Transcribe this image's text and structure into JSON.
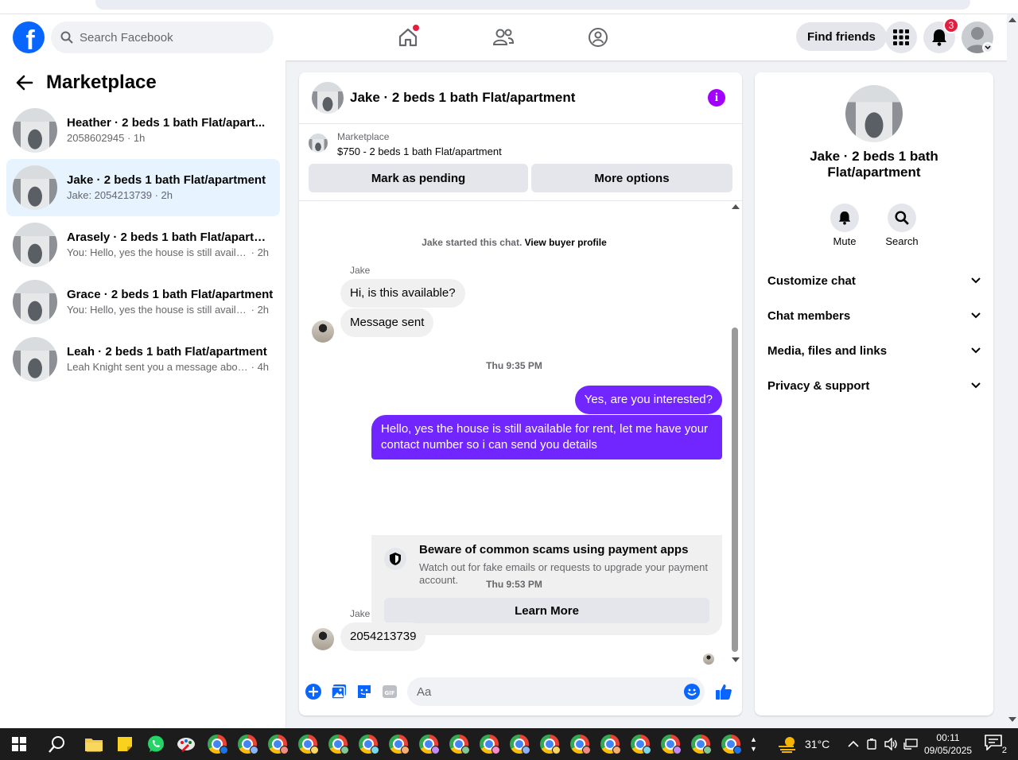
{
  "navbar": {
    "search_placeholder": "Search Facebook",
    "find_friends_label": "Find friends",
    "notification_count": "3"
  },
  "sidebar": {
    "title": "Marketplace",
    "conversations": [
      {
        "title": "Heather · 2 beds 1 bath Flat/apart...",
        "preview": "2058602945",
        "time": "· 1h",
        "active": false
      },
      {
        "title": "Jake · 2 beds 1 bath Flat/apartment",
        "preview": "Jake: 2054213739",
        "time": "· 2h",
        "active": true
      },
      {
        "title": "Arasely · 2 beds 1 bath Flat/apartm...",
        "preview": "You: Hello, yes the house is still availa...",
        "time": "· 2h",
        "active": false
      },
      {
        "title": "Grace · 2 beds 1 bath Flat/apartment",
        "preview": "You: Hello, yes the house is still availa...",
        "time": "· 2h",
        "active": false
      },
      {
        "title": "Leah · 2 beds 1 bath Flat/apartment",
        "preview": "Leah Knight sent you a message abou...",
        "time": "· 4h",
        "active": false
      }
    ]
  },
  "chat": {
    "header_title": "Jake · 2 beds 1 bath Flat/apartment",
    "listing": {
      "source": "Marketplace",
      "price_title": "$750 - 2 beds 1 bath Flat/apartment",
      "mark_pending_label": "Mark as pending",
      "more_options_label": "More options"
    },
    "started_text": "Jake started this chat.",
    "view_profile_label": "View buyer profile",
    "sender_name": "Jake",
    "msg_hi": "Hi, is this available?",
    "msg_sent": "Message sent",
    "time_1": "Thu 9:35 PM",
    "msg_out_1": "Yes, are you interested?",
    "msg_out_2": "Hello, yes the house is still available for rent, let me have your contact number so i can send you details",
    "scam_title": "Beware of common scams using payment apps",
    "scam_body": "Watch out for fake emails or requests to upgrade your payment account.",
    "learn_more_label": "Learn More",
    "time_2": "Thu 9:53 PM",
    "msg_number": "2054213739",
    "composer_placeholder": "Aa"
  },
  "info_pane": {
    "name": "Jake · 2 beds 1 bath Flat/apartment",
    "mute_label": "Mute",
    "search_label": "Search",
    "rows": [
      "Customize chat",
      "Chat members",
      "Media, files and links",
      "Privacy & support"
    ]
  },
  "taskbar": {
    "temperature": "31°C",
    "time": "00:11",
    "date": "09/05/2025",
    "notification_count": "2"
  },
  "colors": {
    "facebook_blue": "#0866ff",
    "outgoing_bubble": "#7126ff",
    "active_conversation": "#e7f3ff",
    "notification_red": "#e41e3f"
  }
}
